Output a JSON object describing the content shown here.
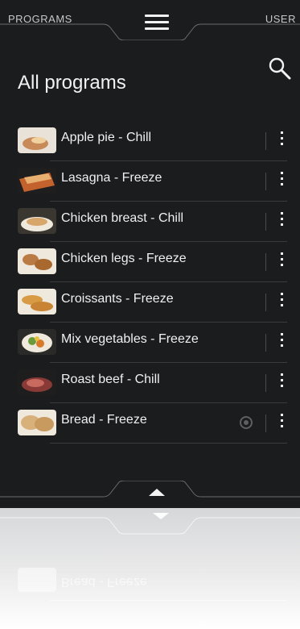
{
  "header": {
    "left_tab": "PROGRAMS",
    "right_tab": "USER",
    "menu_icon": "hamburger-menu-icon"
  },
  "main": {
    "title": "All programs",
    "search_icon": "search-icon"
  },
  "programs": [
    {
      "label": "Apple pie - Chill",
      "thumb_color": "#c98a5a"
    },
    {
      "label": "Lasagna - Freeze",
      "thumb_color": "#c4622e"
    },
    {
      "label": "Chicken breast - Chill",
      "thumb_color": "#d6a66a"
    },
    {
      "label": "Chicken legs - Freeze",
      "thumb_color": "#b97a44"
    },
    {
      "label": "Croissants - Freeze",
      "thumb_color": "#d89a44"
    },
    {
      "label": "Mix vegetables - Freeze",
      "thumb_color": "#6a9a3a"
    },
    {
      "label": "Roast beef - Chill",
      "thumb_color": "#8a3a36"
    },
    {
      "label": "Bread - Freeze",
      "thumb_color": "#d8b07a",
      "has_eye_icon": true
    }
  ],
  "reflection": {
    "label": "Bread - Freeze"
  },
  "colors": {
    "background": "#1b1c1e",
    "text": "#f0f0f0",
    "divider": "#3a3b3d"
  },
  "footer": {
    "up_icon": "chevron-up-icon"
  }
}
